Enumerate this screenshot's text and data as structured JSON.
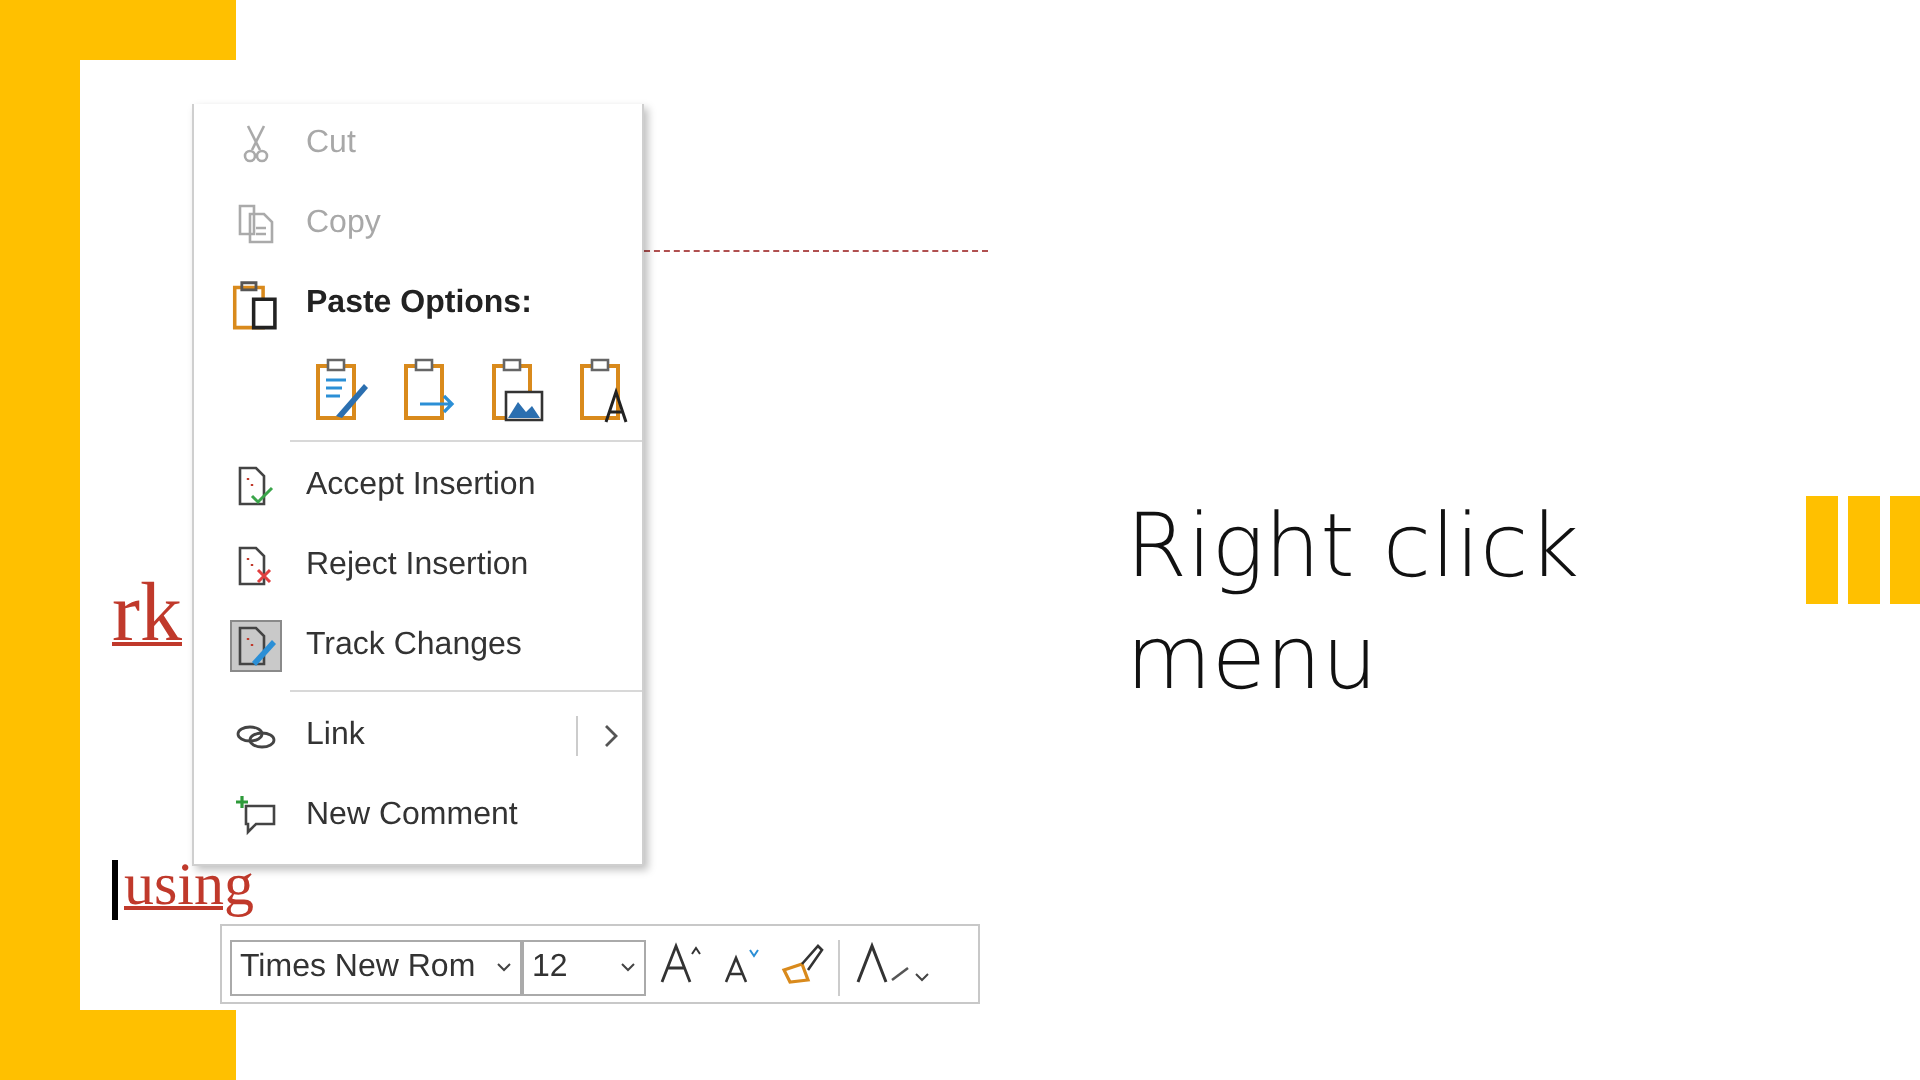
{
  "document": {
    "fragments": [
      "rk",
      "using"
    ]
  },
  "context_menu": {
    "items": [
      {
        "kind": "command",
        "label": "Cut",
        "disabled": true,
        "checked": false,
        "submenu": false
      },
      {
        "kind": "command",
        "label": "Copy",
        "disabled": true,
        "checked": false,
        "submenu": false
      },
      {
        "kind": "header",
        "label": "Paste Options:"
      },
      {
        "kind": "paste_options"
      },
      {
        "kind": "separator"
      },
      {
        "kind": "command",
        "label": "Accept Insertion",
        "disabled": false,
        "checked": false,
        "submenu": false
      },
      {
        "kind": "command",
        "label": "Reject Insertion",
        "disabled": false,
        "checked": false,
        "submenu": false
      },
      {
        "kind": "command",
        "label": "Track Changes",
        "disabled": false,
        "checked": true,
        "submenu": false
      },
      {
        "kind": "separator"
      },
      {
        "kind": "command",
        "label": "Link",
        "disabled": false,
        "checked": false,
        "submenu": true
      },
      {
        "kind": "command",
        "label": "New Comment",
        "disabled": false,
        "checked": false,
        "submenu": false
      }
    ]
  },
  "mini_toolbar": {
    "font": "Times New Rom",
    "size": "12"
  },
  "slide": {
    "title": "Right click menu"
  }
}
